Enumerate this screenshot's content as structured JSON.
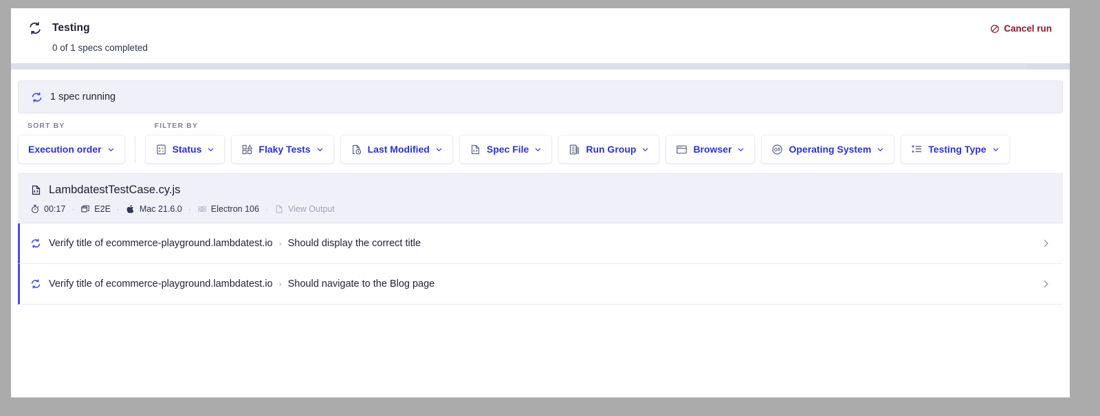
{
  "header": {
    "icon": "refresh-cycle-icon",
    "title": "Testing",
    "subtitle": "0 of 1 specs completed",
    "cancel_label": "Cancel run",
    "cancel_icon": "prohibited-icon",
    "cancel_color": "#8b1b2b"
  },
  "progress": {
    "percent": 96
  },
  "running_banner": {
    "icon": "refresh-icon",
    "label": "1 spec running",
    "accent_color": "#4a4ed8",
    "background": "#eff0f8"
  },
  "controls": {
    "sort": {
      "group_label": "SORT BY",
      "buttons": [
        {
          "label": "Execution order",
          "icon": null
        }
      ]
    },
    "filter": {
      "group_label": "FILTER BY",
      "buttons": [
        {
          "label": "Status",
          "icon": "status-checklist-icon"
        },
        {
          "label": "Flaky Tests",
          "icon": "flaky-grid-icon"
        },
        {
          "label": "Last Modified",
          "icon": "document-clock-icon"
        },
        {
          "label": "Spec File",
          "icon": "code-file-icon"
        },
        {
          "label": "Run Group",
          "icon": "stacked-documents-icon"
        },
        {
          "label": "Browser",
          "icon": "browser-window-icon"
        },
        {
          "label": "Operating System",
          "icon": "os-circle-icon"
        },
        {
          "label": "Testing Type",
          "icon": "testing-type-list-icon"
        }
      ]
    },
    "chevron_icon": "chevron-down-icon",
    "label_color": "#2b31d4"
  },
  "spec": {
    "icon": "code-file-icon",
    "name": "LambdatestTestCase.cy.js",
    "meta": [
      {
        "icon": "stopwatch-icon",
        "label": "00:17",
        "muted": false
      },
      {
        "icon": "stacked-windows-icon",
        "label": "E2E",
        "muted": false
      },
      {
        "icon": "apple-icon",
        "label": "Mac 21.6.0",
        "muted": false
      },
      {
        "icon": "electron-atom-icon",
        "label": "Electron 106",
        "muted": false,
        "dim_icon": true
      },
      {
        "icon": "output-document-icon",
        "label": "View Output",
        "muted": true
      }
    ],
    "separator": "·"
  },
  "tests": [
    {
      "status_icon": "running-spinner-icon",
      "suite": "Verify title of ecommerce-playground.lambdatest.io",
      "separator": "›",
      "name": "Should display the correct title",
      "chevron": "chevron-right-icon"
    },
    {
      "status_icon": "running-spinner-icon",
      "suite": "Verify title of ecommerce-playground.lambdatest.io",
      "separator": "›",
      "name": "Should navigate to the Blog page",
      "chevron": "chevron-right-icon"
    }
  ]
}
